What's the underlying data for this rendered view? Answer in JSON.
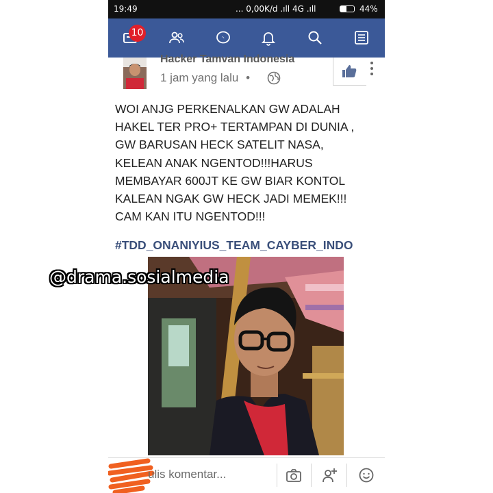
{
  "status_bar": {
    "time": "19:49",
    "network": "... 0,00K/d  .ıll 4G .ıll",
    "battery_percent": "44%",
    "battery_level": 0.44
  },
  "navbar": {
    "color": "#3b5998",
    "notification_count": "10",
    "icons": [
      "news-feed-icon",
      "friends-icon",
      "messenger-icon",
      "notifications-bell-icon",
      "search-icon",
      "menu-icon"
    ]
  },
  "post": {
    "author_name": "Hacker Tamvan Indonesia",
    "time_ago": "1 jam yang lalu",
    "separator": "•",
    "audience_icon": "globe-icon",
    "text_lines": [
      "WOI ANJG PERKENALKAN GW ADALAH",
      "HAKEL TER PRO+ TERTAMPAN DI DUNIA ,",
      "GW BARUSAN HECK SATELIT NASA,",
      "KELEAN ANAK NGENTOD!!!HARUS",
      "MEMBAYAR 600JT KE GW BIAR KONTOL",
      "KALEAN NGAK GW HECK JADI MEMEK!!!",
      "CAM KAN ITU NGENTOD!!!"
    ],
    "hashtag": "#TDD_ONANIYIUS_TEAM_CAYBER_INDO"
  },
  "comment_bar": {
    "placeholder": "ulis komentar...",
    "icons": [
      "camera-icon",
      "add-person-icon",
      "emoji-icon"
    ]
  },
  "watermark": "@drama.sosialmedia"
}
